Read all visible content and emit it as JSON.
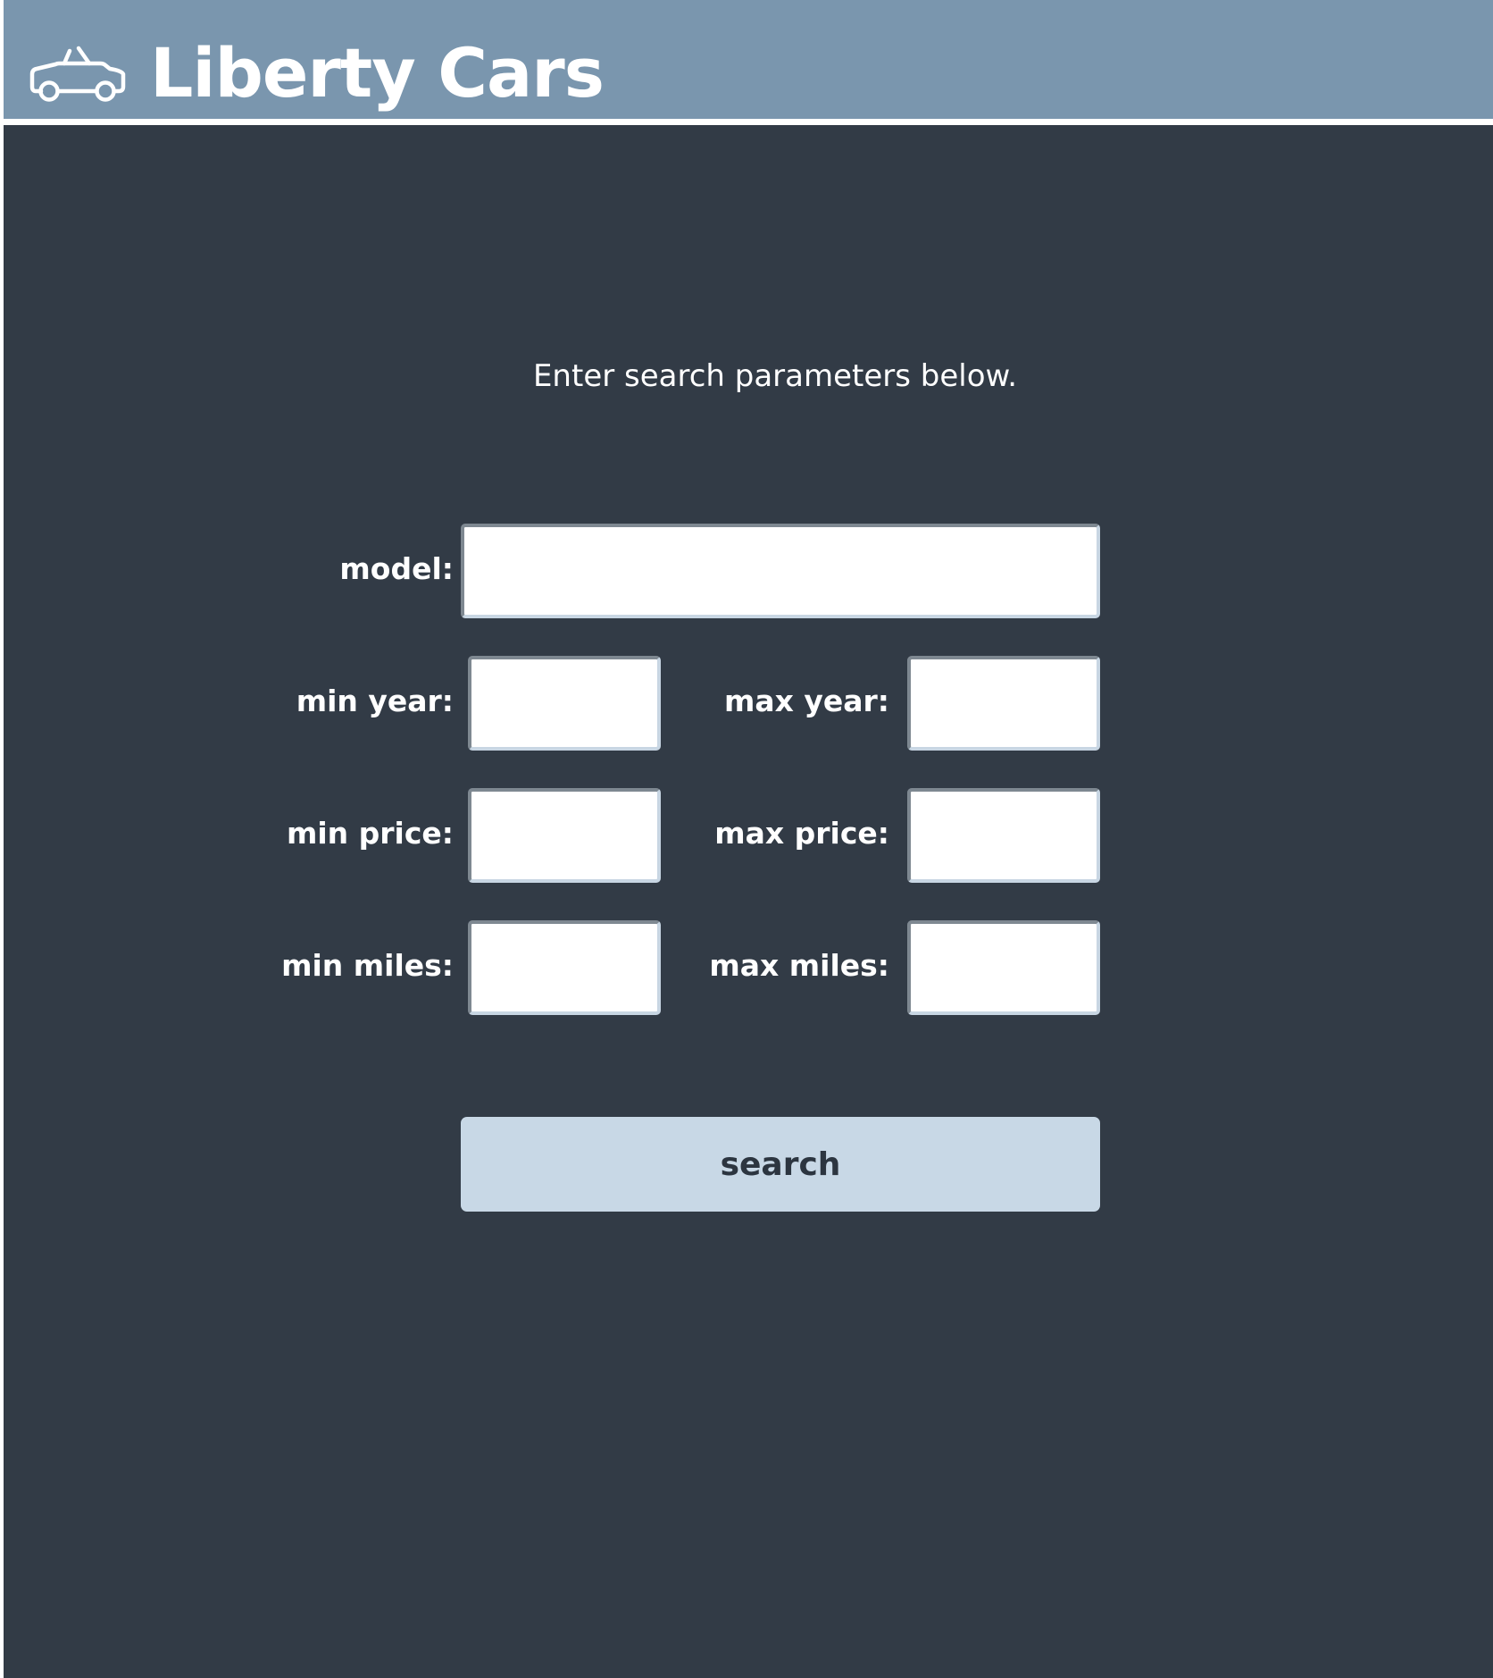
{
  "header": {
    "title": "Liberty Cars",
    "logo_icon": "car-icon"
  },
  "instructions": "Enter search parameters below.",
  "form": {
    "model": {
      "label": "model:",
      "value": ""
    },
    "min_year": {
      "label": "min year:",
      "value": ""
    },
    "max_year": {
      "label": "max year:",
      "value": ""
    },
    "min_price": {
      "label": "min price:",
      "value": ""
    },
    "max_price": {
      "label": "max price:",
      "value": ""
    },
    "min_miles": {
      "label": "min miles:",
      "value": ""
    },
    "max_miles": {
      "label": "max miles:",
      "value": ""
    },
    "submit_label": "search"
  },
  "colors": {
    "header_bg": "#7a96ae",
    "page_bg": "#323b46",
    "button_bg": "#c8d8e6",
    "button_text": "#2c3540"
  }
}
